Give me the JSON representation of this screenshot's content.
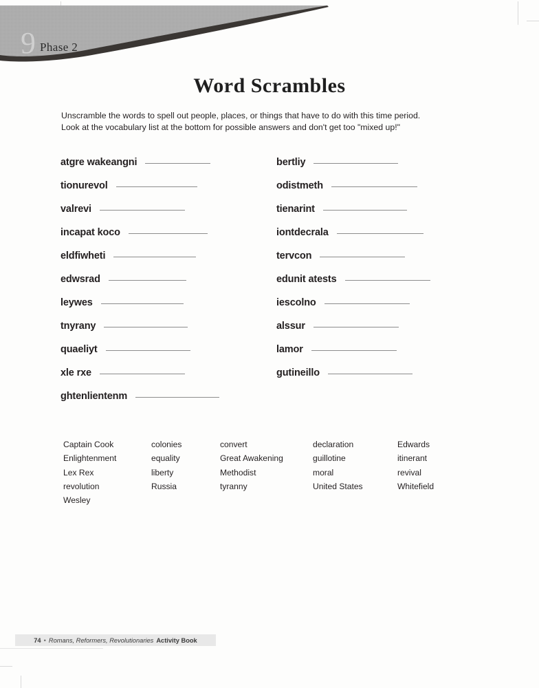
{
  "header": {
    "phase_number": "9",
    "phase_label": "Phase 2"
  },
  "title": "Word Scrambles",
  "instructions": {
    "line1": "Unscramble the words to spell out people, places, or things that have to do with this time period.",
    "line2": "Look at the vocabulary list at the bottom for possible answers and don't get too \"mixed up!\""
  },
  "scrambles": {
    "left": [
      {
        "word": "atgre wakeangni",
        "line_width": 95
      },
      {
        "word": "tionurevol",
        "line_width": 118
      },
      {
        "word": "valrevi",
        "line_width": 124
      },
      {
        "word": "incapat koco",
        "line_width": 115
      },
      {
        "word": "eldfiwheti",
        "line_width": 120
      },
      {
        "word": "edwsrad",
        "line_width": 113
      },
      {
        "word": "leywes",
        "line_width": 120
      },
      {
        "word": "tnyrany",
        "line_width": 122
      },
      {
        "word": "quaeliyt",
        "line_width": 123
      },
      {
        "word": "xle rxe",
        "line_width": 124
      },
      {
        "word": "ghtenlientenm",
        "line_width": 122
      }
    ],
    "right": [
      {
        "word": "bertliy",
        "line_width": 123
      },
      {
        "word": "odistmeth",
        "line_width": 125
      },
      {
        "word": "tienarint",
        "line_width": 122
      },
      {
        "word": "iontdecrala",
        "line_width": 126
      },
      {
        "word": "tervcon",
        "line_width": 124
      },
      {
        "word": "edunit atests",
        "line_width": 124
      },
      {
        "word": "iescolno",
        "line_width": 124
      },
      {
        "word": "alssur",
        "line_width": 124
      },
      {
        "word": "lamor",
        "line_width": 124
      },
      {
        "word": "gutineillo",
        "line_width": 123
      }
    ]
  },
  "wordbank": {
    "columns": [
      [
        "Captain Cook",
        "Enlightenment",
        "Lex Rex",
        "revolution",
        "Wesley"
      ],
      [
        "colonies",
        "equality",
        "liberty",
        "Russia"
      ],
      [
        "convert",
        "Great Awakening",
        "Methodist",
        "tyranny"
      ],
      [
        "declaration",
        "guillotine",
        "moral",
        "United States"
      ],
      [
        "Edwards",
        "itinerant",
        "revival",
        "Whitefield"
      ]
    ]
  },
  "footer": {
    "page_number": "74",
    "separator": "•",
    "book_title": "Romans, Reformers, Revolutionaries",
    "book_suffix": "Activity Book"
  },
  "colors": {
    "banner_gray": "#ababab",
    "banner_dark": "#3a3633",
    "rule_gray": "#8c8c8c",
    "footer_bar": "#e8e8e8",
    "text": "#231f20"
  }
}
